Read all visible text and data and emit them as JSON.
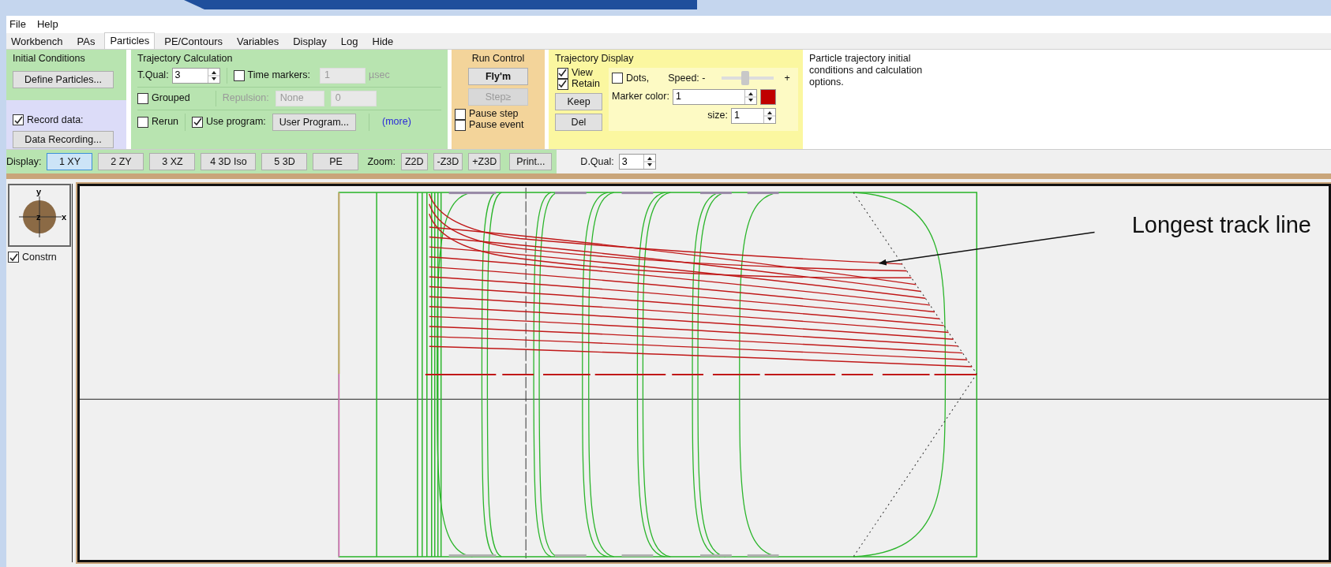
{
  "menu": [
    {
      "label": "File"
    },
    {
      "label": "Help"
    }
  ],
  "tabs": [
    {
      "label": "Workbench",
      "selected": false
    },
    {
      "label": "PAs",
      "selected": false
    },
    {
      "label": "Particles",
      "selected": true
    },
    {
      "label": "PE/Contours",
      "selected": false
    },
    {
      "label": "Variables",
      "selected": false
    },
    {
      "label": "Display",
      "selected": false
    },
    {
      "label": "Log",
      "selected": false
    },
    {
      "label": "Hide",
      "selected": false
    }
  ],
  "initial_conditions": {
    "title": "Initial Conditions",
    "define_button": "Define Particles...",
    "record_data": {
      "label": "Record data:",
      "checked": true
    },
    "recording_button": "Data Recording..."
  },
  "trajectory_calculation": {
    "title": "Trajectory Calculation",
    "tqual_label": "T.Qual:",
    "tqual_value": "3",
    "time_markers": {
      "label": "Time markers:",
      "checked": false
    },
    "time_value": "1",
    "time_unit": "µsec",
    "grouped": {
      "label": "Grouped",
      "checked": false
    },
    "repulsion_label": "Repulsion:",
    "repulsion_value": "None",
    "repulsion_amount": "0",
    "rerun": {
      "label": "Rerun",
      "checked": false
    },
    "use_program": {
      "label": "Use program:",
      "checked": true
    },
    "program_button": "User Program...",
    "more_link": "(more)"
  },
  "run_control": {
    "title": "Run Control",
    "buttons": [
      {
        "label": "Fly'm",
        "disabled": false
      },
      {
        "label": "Step≥",
        "disabled": true
      }
    ],
    "checks": [
      {
        "label": "Pause step",
        "checked": false
      },
      {
        "label": "Pause event",
        "checked": false
      }
    ]
  },
  "trajectory_display": {
    "title": "Trajectory Display",
    "checks": [
      {
        "label": "View",
        "checked": true
      },
      {
        "label": "Retain",
        "checked": true
      }
    ],
    "buttons": [
      "Keep",
      "Del"
    ],
    "dots": {
      "label": "Dots,",
      "checked": false
    },
    "speed_label": "Speed: -",
    "speed_plus": "+",
    "speed": {
      "level": 0.45
    },
    "marker_color_label": "Marker color:",
    "marker_color_value": "1",
    "marker_swatch": {
      "color": "#c00000"
    },
    "size_label": "size:",
    "size_value": "1"
  },
  "description": "Particle trajectory initial conditions and calculation options.",
  "display_bar": {
    "label": "Display:",
    "views": [
      {
        "label": "1 XY",
        "selected": true
      },
      {
        "label": "2 ZY",
        "selected": false
      },
      {
        "label": "3 XZ",
        "selected": false
      },
      {
        "label": "4 3D Iso",
        "selected": false
      },
      {
        "label": "5 3D",
        "selected": false
      },
      {
        "label": "PE",
        "selected": false
      }
    ],
    "zoom_label": "Zoom:",
    "zoom_buttons": [
      "Z2D",
      "-Z3D",
      "+Z3D"
    ],
    "print_button": "Print...",
    "dqual_label": "D.Qual:",
    "dqual_value": "3"
  },
  "view_panel": {
    "axis_y": "y",
    "axis_z": "z",
    "axis_x": "x",
    "constrain": {
      "label": "Constrn",
      "checked": true
    }
  },
  "canvas": {
    "annotation": "Longest track line"
  }
}
